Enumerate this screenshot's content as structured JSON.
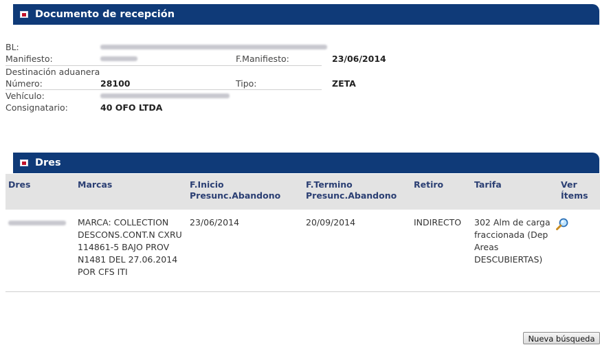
{
  "reception": {
    "title": "Documento de recepción",
    "fields": {
      "bl_label": "BL:",
      "manifiesto_label": "Manifiesto:",
      "fmanifiesto_label": "F.Manifiesto:",
      "fmanifiesto_value": "23/06/2014",
      "destinacion_label": "Destinación aduanera",
      "numero_label": "Número:",
      "numero_value": "28100",
      "tipo_label": "Tipo:",
      "tipo_value": "ZETA",
      "vehiculo_label": "Vehículo:",
      "consignatario_label": "Consignatario:",
      "consignatario_value": "40 OFO LTDA"
    }
  },
  "dres": {
    "title": "Dres",
    "headers": {
      "dres": "Dres",
      "marcas": "Marcas",
      "finicio": "F.Inicio Presunc.Abandono",
      "ftermino": "F.Termino Presunc.Abandono",
      "retiro": "Retiro",
      "tarifa": "Tarifa",
      "ver": "Ver Ítems"
    },
    "rows": [
      {
        "marcas": "MARCA: COLLECTION DESCONS.CONT.N CXRU 114861-5 BAJO PROV N1481 DEL 27.06.2014 POR CFS ITI",
        "finicio": "23/06/2014",
        "ftermino": "20/09/2014",
        "retiro": "INDIRECTO",
        "tarifa": "302 Alm de carga fraccionada (Dep Areas DESCUBIERTAS)"
      }
    ]
  },
  "actions": {
    "new_search": "Nueva búsqueda"
  }
}
